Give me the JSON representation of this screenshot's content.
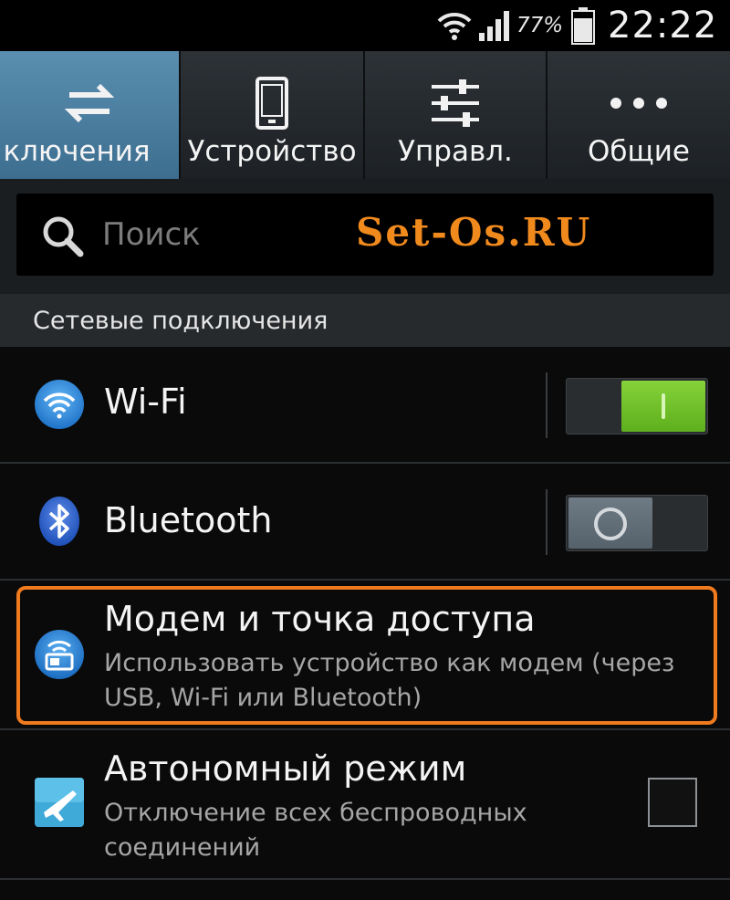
{
  "status_bar": {
    "wifi_icon": "wifi-icon",
    "signal_icon": "signal-icon",
    "battery_percent": "77%",
    "battery_icon": "battery-icon",
    "time": "22:22"
  },
  "tabs": [
    {
      "label": "ключения",
      "icon": "transfer-arrows-icon",
      "active": true
    },
    {
      "label": "Устройство",
      "icon": "phone-icon",
      "active": false
    },
    {
      "label": "Управл.",
      "icon": "sliders-icon",
      "active": false
    },
    {
      "label": "Общие",
      "icon": "more-dots-icon",
      "active": false
    }
  ],
  "search": {
    "placeholder": "Поиск",
    "watermark": "Set-Os.RU"
  },
  "section": {
    "title": "Сетевые подключения"
  },
  "items": [
    {
      "title": "Wi-Fi",
      "icon": "wifi-icon",
      "toggle": "on"
    },
    {
      "title": "Bluetooth",
      "icon": "bluetooth-icon",
      "toggle": "off"
    },
    {
      "title": "Модем и точка доступа",
      "subtitle_line1": "Использовать устройство как модем (через",
      "subtitle_line2": "USB, Wi-Fi или Bluetooth)",
      "icon": "tethering-icon",
      "highlighted": true
    },
    {
      "title": "Автономный режим",
      "subtitle_line1": "Отключение всех беспроводных",
      "subtitle_line2": "соединений",
      "icon": "airplane-icon",
      "checked": false
    }
  ],
  "colors": {
    "accent_tab": "#4a7fa3",
    "toggle_on": "#6cc02a",
    "highlight_border": "#f07a1e",
    "watermark": "#f08a1d"
  }
}
